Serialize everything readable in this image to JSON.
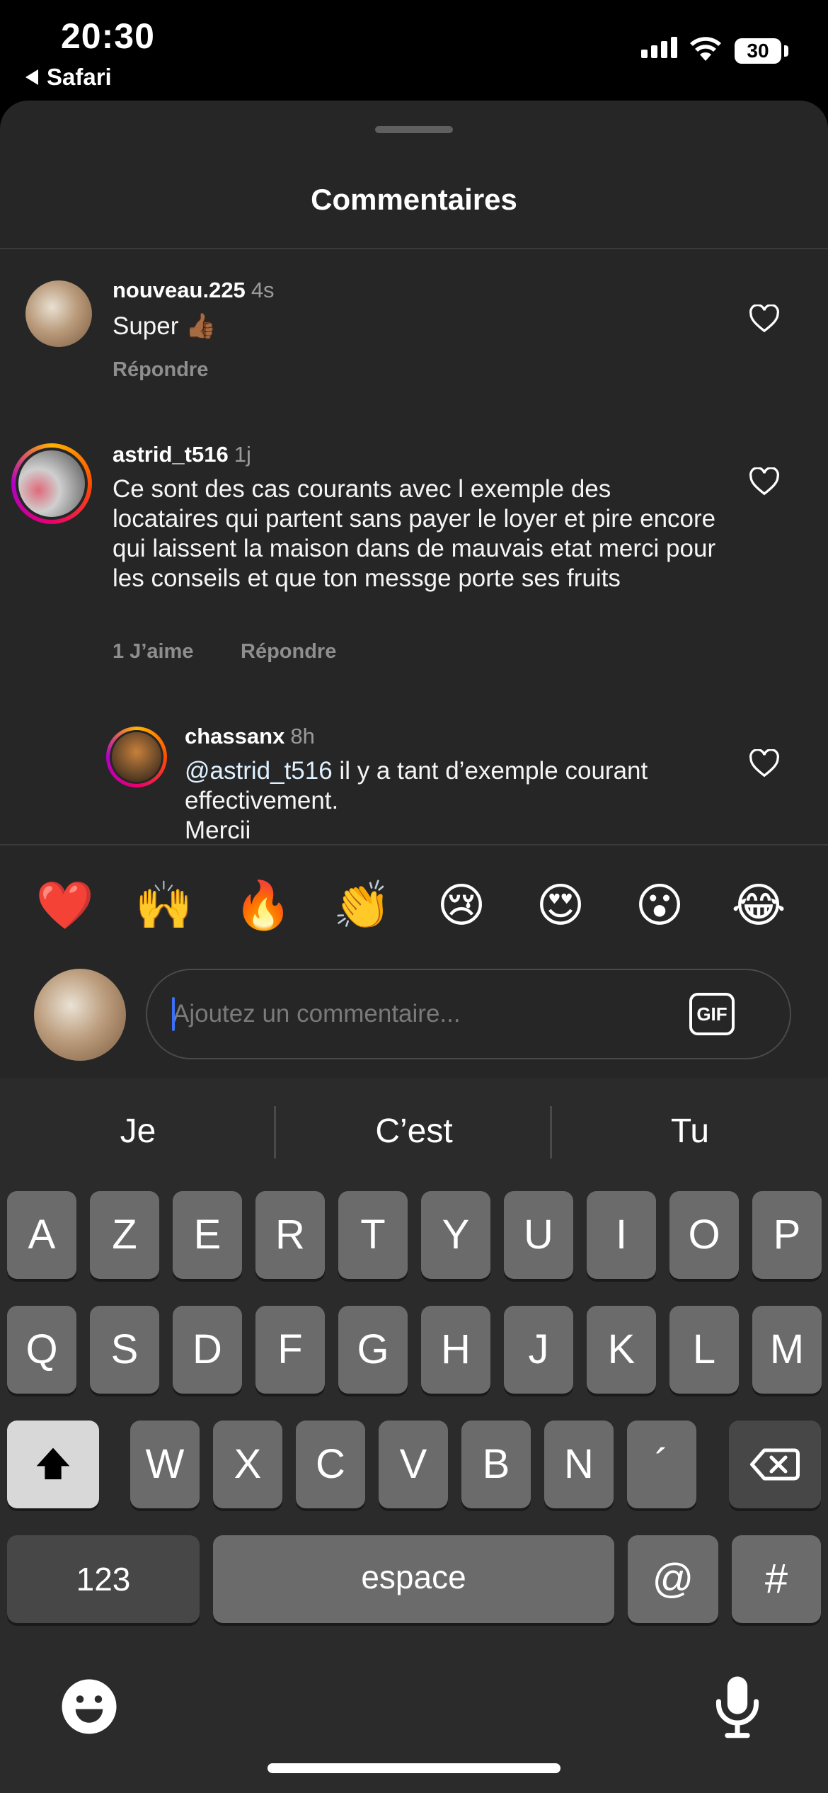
{
  "status_bar": {
    "time": "20:30",
    "back_app": "Safari",
    "battery": "30"
  },
  "sheet": {
    "title": "Commentaires"
  },
  "comments": [
    {
      "username": "nouveau.225",
      "ago": "4s",
      "text": "Super 👍🏾",
      "likes": "",
      "reply": "Répondre"
    },
    {
      "username": "astrid_t516",
      "ago": "1j",
      "text": "Ce sont des cas courants avec l exemple des locataires qui partent sans payer le loyer et pire encore qui laissent la maison dans de mauvais etat merci pour les conseils et que ton messge porte ses fruits",
      "likes": "1 J’aime",
      "reply": "Répondre"
    },
    {
      "username": "chassanx",
      "ago": "8h",
      "mention": "@astrid_t516",
      "text": " il y a tant d’exemple courant effectivement.",
      "text2": "Mercii"
    }
  ],
  "reactions": [
    "❤️",
    "🙌",
    "🔥",
    "👏",
    "😢",
    "😍",
    "😮",
    "😂"
  ],
  "composer": {
    "placeholder": "Ajoutez un commentaire...",
    "gif_label": "GIF"
  },
  "keyboard": {
    "suggestions": [
      "Je",
      "C’est",
      "Tu"
    ],
    "row1": [
      "A",
      "Z",
      "E",
      "R",
      "T",
      "Y",
      "U",
      "I",
      "O",
      "P"
    ],
    "row2": [
      "Q",
      "S",
      "D",
      "F",
      "G",
      "H",
      "J",
      "K",
      "L",
      "M"
    ],
    "row3": [
      "W",
      "X",
      "C",
      "V",
      "B",
      "N",
      "´"
    ],
    "numbers_key": "123",
    "space_key": "espace",
    "at_key": "@",
    "hash_key": "#"
  }
}
